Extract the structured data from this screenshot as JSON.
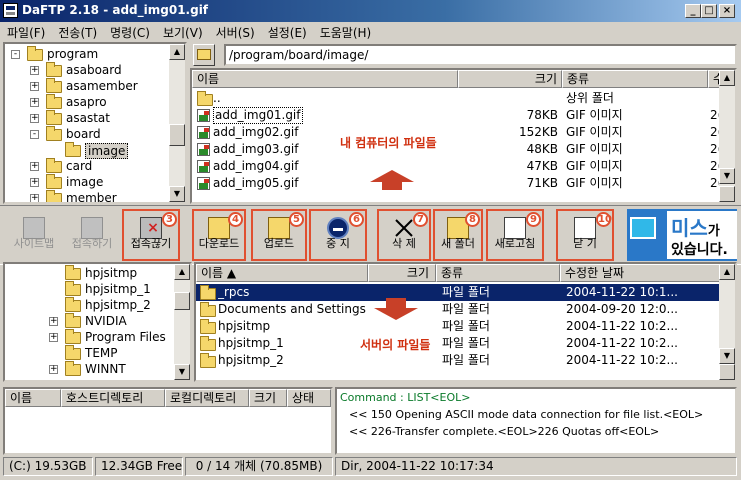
{
  "window": {
    "title": "DaFTP 2.18 - add_img01.gif"
  },
  "menu": [
    "파일(F)",
    "전송(T)",
    "명령(C)",
    "보기(V)",
    "서버(S)",
    "설정(E)",
    "도움말(H)"
  ],
  "local_tree": [
    {
      "label": "program",
      "level": 0,
      "exp": "-"
    },
    {
      "label": "asaboard",
      "level": 1,
      "exp": "+"
    },
    {
      "label": "asamember",
      "level": 1,
      "exp": "+"
    },
    {
      "label": "asapro",
      "level": 1,
      "exp": "+"
    },
    {
      "label": "asastat",
      "level": 1,
      "exp": "+"
    },
    {
      "label": "board",
      "level": 1,
      "exp": "-"
    },
    {
      "label": "image",
      "level": 2,
      "exp": ""
    },
    {
      "label": "card",
      "level": 1,
      "exp": "+"
    },
    {
      "label": "image",
      "level": 1,
      "exp": "+"
    },
    {
      "label": "member",
      "level": 1,
      "exp": "+"
    }
  ],
  "local_path": "/program/board/image/",
  "local_headers": [
    "이름",
    "크기",
    "종류",
    "수"
  ],
  "local_files": [
    {
      "name": "..",
      "size": "",
      "type": "상위 폴더",
      "extra": "",
      "icon": "folder"
    },
    {
      "name": "add_img01.gif",
      "size": "78KB",
      "type": "GIF 이미지",
      "extra": "2(",
      "icon": "gif"
    },
    {
      "name": "add_img02.gif",
      "size": "152KB",
      "type": "GIF 이미지",
      "extra": "2(",
      "icon": "gif"
    },
    {
      "name": "add_img03.gif",
      "size": "48KB",
      "type": "GIF 이미지",
      "extra": "2(",
      "icon": "gif"
    },
    {
      "name": "add_img04.gif",
      "size": "47KB",
      "type": "GIF 이미지",
      "extra": "2(",
      "icon": "gif"
    },
    {
      "name": "add_img05.gif",
      "size": "71KB",
      "type": "GIF 이미지",
      "extra": "2(",
      "icon": "gif"
    }
  ],
  "local_note": "내 컴퓨터의 파일들",
  "toolbar": [
    {
      "label": "사이트맵",
      "num": "",
      "disabled": true
    },
    {
      "label": "접속하기",
      "num": "",
      "disabled": true
    },
    {
      "label": "접속끊기",
      "num": "①",
      "disabled": false
    },
    {
      "label": "다운로드",
      "num": "②",
      "disabled": false
    },
    {
      "label": "업로드",
      "num": "③",
      "disabled": false
    },
    {
      "label": "중 지",
      "num": "④",
      "disabled": false
    },
    {
      "label": "삭 제",
      "num": "⑤",
      "disabled": false
    },
    {
      "label": "새 폴더",
      "num": "⑥",
      "disabled": false
    },
    {
      "label": "새로고침",
      "num": "⑦",
      "disabled": false
    },
    {
      "label": "닫 기",
      "num": "⑧",
      "disabled": false
    }
  ],
  "banner": {
    "line1": "미스",
    "line1b": "가",
    "line2": "있습니다."
  },
  "remote_tree": [
    {
      "label": "hpjsitmp",
      "exp": ""
    },
    {
      "label": "hpjsitmp_1",
      "exp": ""
    },
    {
      "label": "hpjsitmp_2",
      "exp": ""
    },
    {
      "label": "NVIDIA",
      "exp": "+"
    },
    {
      "label": "Program Files",
      "exp": "+"
    },
    {
      "label": "TEMP",
      "exp": ""
    },
    {
      "label": "WINNT",
      "exp": "+"
    }
  ],
  "remote_headers": [
    "이름 ▲",
    "크기",
    "종류",
    "수정한 날짜"
  ],
  "remote_files": [
    {
      "name": "_rpcs",
      "size": "",
      "type": "파일 폴더",
      "date": "2004-11-22 10:1..."
    },
    {
      "name": "Documents and Settings",
      "size": "",
      "type": "파일 폴더",
      "date": "2004-09-20 12:0..."
    },
    {
      "name": "hpjsitmp",
      "size": "",
      "type": "파일 폴더",
      "date": "2004-11-22 10:2..."
    },
    {
      "name": "hpjsitmp_1",
      "size": "",
      "type": "파일 폴더",
      "date": "2004-11-22 10:2..."
    },
    {
      "name": "hpjsitmp_2",
      "size": "",
      "type": "파일 폴더",
      "date": "2004-11-22 10:2..."
    }
  ],
  "remote_note": "서버의 파일들",
  "queue_headers": [
    "이름",
    "호스트디렉토리",
    "로컬디렉토리",
    "크기",
    "상태"
  ],
  "log": {
    "command": "Command : LIST<EOL>",
    "lines": [
      "<< 150 Opening ASCII mode data connection for file list.<EOL>",
      "<< 226-Transfer complete.<EOL>226 Quotas off<EOL>"
    ]
  },
  "status": [
    "(C:) 19.53GB",
    "12.34GB Free",
    "0 / 14 개체 (70.85MB)",
    "Dir, 2004-11-22 10:17:34"
  ]
}
